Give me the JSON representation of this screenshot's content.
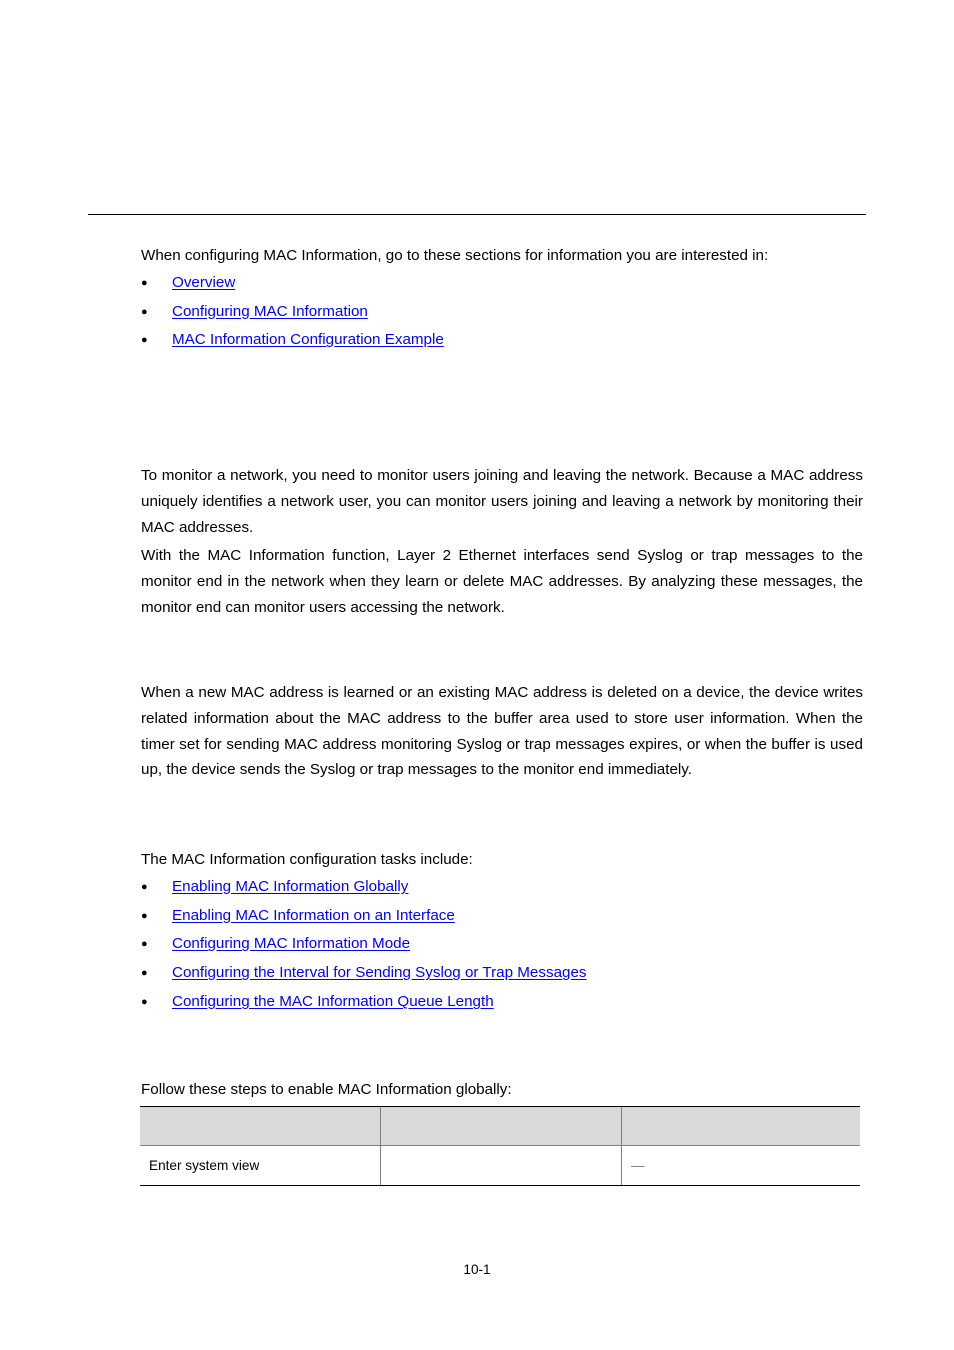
{
  "page": {
    "intro": "When configuring MAC Information, go to these sections for information you are interested in:",
    "toc_links": [
      {
        "label": "Overview"
      },
      {
        "label": "Configuring MAC Information"
      },
      {
        "label": "MAC Information Configuration Example"
      }
    ],
    "overview_paragraphs": [
      "To monitor a network, you need to monitor users joining and leaving the network. Because a MAC address uniquely identifies a network user, you can monitor users joining and leaving a network by monitoring their MAC addresses.",
      "With the MAC Information function, Layer 2 Ethernet interfaces send Syslog or trap messages to the monitor end in the network when they learn or delete MAC addresses. By analyzing these messages, the monitor end can monitor users accessing the network."
    ],
    "working_paragraph": "When a new MAC address is learned or an existing MAC address is deleted on a device, the device writes related information about the MAC address to the buffer area used to store user information. When the timer set for sending MAC address monitoring Syslog or trap messages expires, or when the buffer is used up, the device sends the Syslog or trap messages to the monitor end immediately.",
    "tasks_intro": "The MAC Information configuration tasks include:",
    "task_links": [
      {
        "label": "Enabling MAC Information Globally"
      },
      {
        "label": "Enabling MAC Information on an Interface"
      },
      {
        "label": "Configuring MAC Information Mode"
      },
      {
        "label": "Configuring the Interval for Sending Syslog or Trap Messages"
      },
      {
        "label": "Configuring the MAC Information Queue Length"
      }
    ],
    "steps_intro": "Follow these steps to enable MAC Information globally:",
    "steps_table": {
      "headers": [
        "",
        "",
        ""
      ],
      "rows": [
        [
          "Enter system view",
          "",
          "—"
        ]
      ]
    },
    "bullet_glyph": "●",
    "page_number": "10-1"
  },
  "colors": {
    "link": "#0000ff",
    "table_header_bg": "#d9d9d9"
  }
}
